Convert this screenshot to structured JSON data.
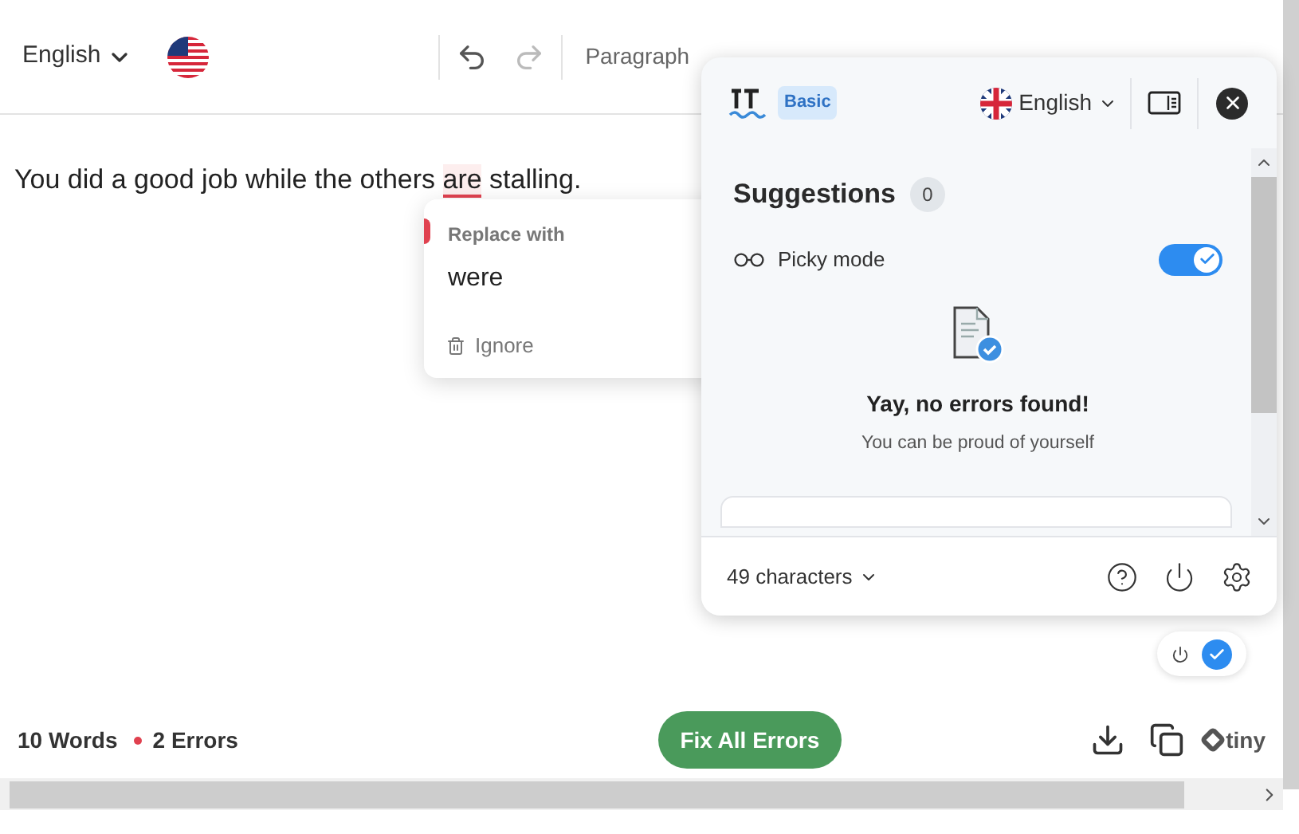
{
  "toolbar": {
    "language": "English",
    "style": "Paragraph"
  },
  "editor": {
    "parts": [
      {
        "text": "You did a good job while the others ",
        "error": false
      },
      {
        "text": "are",
        "error": true
      },
      {
        "text": " stalling.",
        "error": false
      }
    ]
  },
  "suggestion_popup": {
    "heading": "Replace with",
    "replacement": "were",
    "ignore": "Ignore"
  },
  "panel": {
    "plan": "Basic",
    "language": "English",
    "title": "Suggestions",
    "count": "0",
    "picky_mode": {
      "label": "Picky mode",
      "on": true
    },
    "empty_title": "Yay, no errors found!",
    "empty_text": "You can be proud of yourself",
    "characters": "49 characters"
  },
  "mini_toggle": {
    "on": true
  },
  "status_bar": {
    "words": "10 Words",
    "errors": "2 Errors",
    "fix_button": "Fix All Errors",
    "logo": "tiny"
  }
}
